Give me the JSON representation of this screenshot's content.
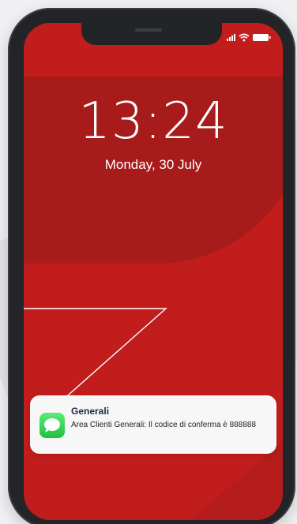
{
  "lock_screen": {
    "time": "13:24",
    "date": "Monday, 30 July"
  },
  "status_bar": {
    "icons": [
      "cellular-signal-icon",
      "wifi-icon",
      "battery-icon"
    ]
  },
  "notification": {
    "app_icon": "messages-icon",
    "sender": "Generali",
    "body": "Area Clienti Generali: Il codice di conferma è 888888"
  },
  "colors": {
    "wallpaper_red": "#c21d1d",
    "wallpaper_dark_red": "#a81b1b",
    "frame": "#232427",
    "messages_green": "#2ad04a"
  }
}
